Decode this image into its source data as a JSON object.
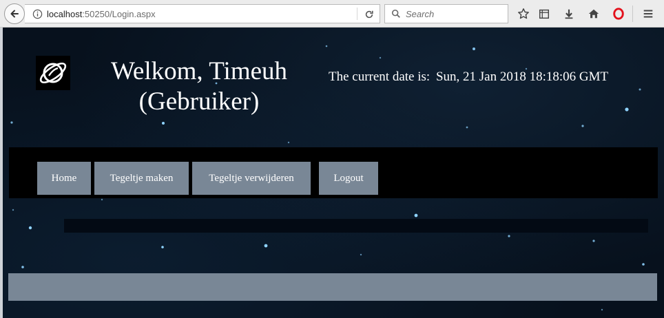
{
  "browser": {
    "url_host": "localhost",
    "url_path": ":50250/Login.aspx",
    "search_placeholder": "Search"
  },
  "colors": {
    "page_background": "#07111d",
    "nav_background": "#000000",
    "button": "#798796",
    "text": "#ffffff"
  },
  "header": {
    "logo_icon": "planet-icon",
    "welcome_line1": "Welkom, Timeuh",
    "welcome_line2": "(Gebruiker)",
    "date_label": "The current date is:",
    "date_value": "Sun, 21 Jan 2018 18:18:06 GMT"
  },
  "nav": {
    "items": [
      {
        "label": "Home"
      },
      {
        "label": "Tegeltje maken"
      },
      {
        "label": "Tegeltje verwijderen"
      },
      {
        "label": "Logout"
      }
    ]
  }
}
